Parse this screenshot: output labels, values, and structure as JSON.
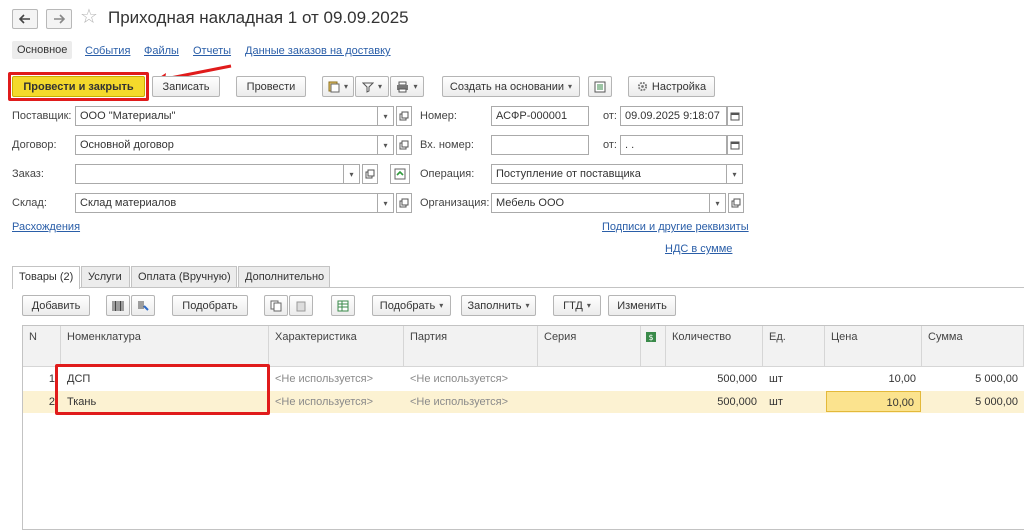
{
  "window": {
    "title": "Приходная накладная 1 от 09.09.2025"
  },
  "sections": {
    "main": "Основное",
    "events": "События",
    "files": "Файлы",
    "reports": "Отчеты",
    "delivery": "Данные заказов на доставку"
  },
  "toolbar": {
    "post_close": "Провести и закрыть",
    "save": "Записать",
    "post": "Провести",
    "create_based": "Создать на основании",
    "settings": "Настройка"
  },
  "form": {
    "supplier_label": "Поставщик:",
    "supplier_value": "ООО \"Материалы\"",
    "contract_label": "Договор:",
    "contract_value": "Основной договор",
    "order_label": "Заказ:",
    "order_value": "",
    "warehouse_label": "Склад:",
    "warehouse_value": "Склад материалов",
    "number_label": "Номер:",
    "number_value": "АСФР-000001",
    "from_label": "от:",
    "date_value": "09.09.2025  9:18:07",
    "in_number_label": "Вх. номер:",
    "in_number_value": "",
    "from_label2": "от:",
    "in_date_value": "  .  .",
    "operation_label": "Операция:",
    "operation_value": "Поступление от поставщика",
    "organization_label": "Организация:",
    "organization_value": "Мебель ООО",
    "discrepancies_link": "Расхождения",
    "signatures_link": "Подписи и другие реквизиты",
    "vat_link": "НДС в сумме"
  },
  "tabs": {
    "goods": "Товары (2)",
    "services": "Услуги",
    "payment": "Оплата (Вручную)",
    "additional": "Дополнительно"
  },
  "table_toolbar": {
    "add": "Добавить",
    "pick": "Подобрать",
    "pick_menu": "Подобрать",
    "fill": "Заполнить",
    "gtd": "ГТД",
    "change": "Изменить"
  },
  "table": {
    "headers": {
      "n": "N",
      "nomenclature": "Номенклатура",
      "characteristic": "Характеристика",
      "batch": "Партия",
      "series": "Серия",
      "quantity": "Количество",
      "unit": "Ед.",
      "price": "Цена",
      "sum": "Сумма"
    },
    "rows": [
      {
        "n": "1",
        "nomenclature": "ДСП",
        "characteristic": "<Не используется>",
        "batch": "<Не используется>",
        "series": "",
        "quantity": "500,000",
        "unit": "шт",
        "price": "10,00",
        "sum": "5 000,00"
      },
      {
        "n": "2",
        "nomenclature": "Ткань",
        "characteristic": "<Не используется>",
        "batch": "<Не используется>",
        "series": "",
        "quantity": "500,000",
        "unit": "шт",
        "price": "10,00",
        "sum": "5 000,00"
      }
    ]
  },
  "colors": {
    "primary_button": "#f4d92b",
    "selected_row": "#fcf2d2",
    "active_cell": "#fbe38e",
    "link": "#2a5ea8",
    "highlight_red": "#e01b1b"
  }
}
